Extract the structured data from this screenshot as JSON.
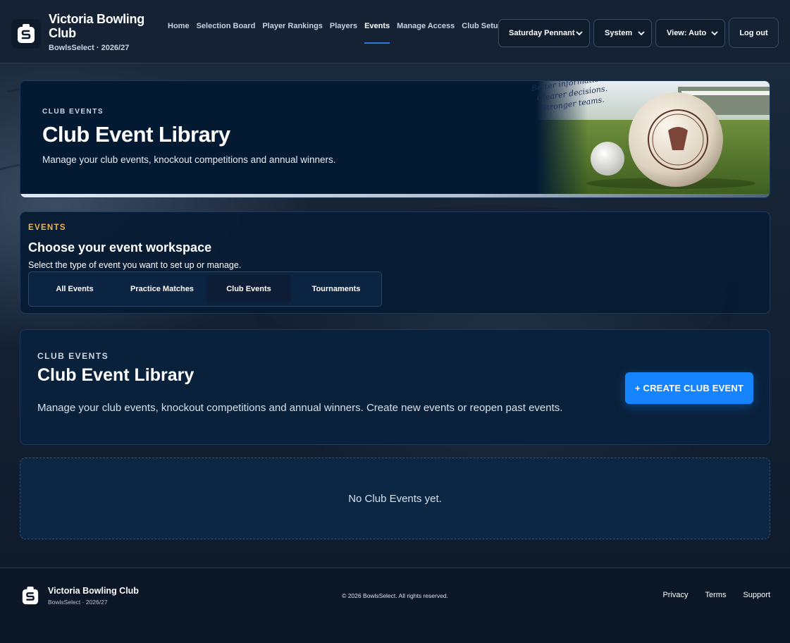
{
  "brand": {
    "name": "Victoria Bowling Club",
    "subtitle": "BowlsSelect · 2026/27",
    "logo_icon": "bowls-select-logo-icon"
  },
  "nav": {
    "items": [
      {
        "label": "Home",
        "active": false
      },
      {
        "label": "Selection Board",
        "active": false
      },
      {
        "label": "Player Rankings",
        "active": false
      },
      {
        "label": "Players",
        "active": false
      },
      {
        "label": "Events",
        "active": true
      },
      {
        "label": "Manage Access",
        "active": false
      },
      {
        "label": "Club Setup",
        "active": false
      }
    ]
  },
  "header_controls": {
    "competition_select": "Saturday Pennant",
    "theme_select": "System",
    "view_select": "View: Auto",
    "logout_label": "Log out"
  },
  "hero": {
    "eyebrow": "CLUB EVENTS",
    "title": "Club Event Library",
    "description": "Manage your club events, knockout competitions and annual winners.",
    "tagline": [
      "Better information.",
      "Clearer decisions.",
      "Stronger teams."
    ]
  },
  "workspace": {
    "eyebrow": "EVENTS",
    "title": "Choose your event workspace",
    "description": "Select the type of event you want to set up or manage.",
    "tabs": [
      {
        "label": "All Events",
        "active": false
      },
      {
        "label": "Practice Matches",
        "active": false
      },
      {
        "label": "Club Events",
        "active": true
      },
      {
        "label": "Tournaments",
        "active": false
      }
    ]
  },
  "library": {
    "eyebrow": "CLUB EVENTS",
    "title": "Club Event Library",
    "description": "Manage your club events, knockout competitions and annual winners. Create new events or reopen past events.",
    "create_label": "+ CREATE CLUB EVENT"
  },
  "empty_state": {
    "text": "No Club Events yet."
  },
  "footer": {
    "name": "Victoria Bowling Club",
    "subtitle": "BowlsSelect · 2026/27",
    "copyright": "© 2026 BowlsSelect. All rights reserved.",
    "links": [
      "Privacy",
      "Terms",
      "Support"
    ]
  },
  "colors": {
    "accent": "#1684ff",
    "eyebrow_gold": "#f0b44a",
    "nav_active_underline": "#2e7bd6"
  }
}
